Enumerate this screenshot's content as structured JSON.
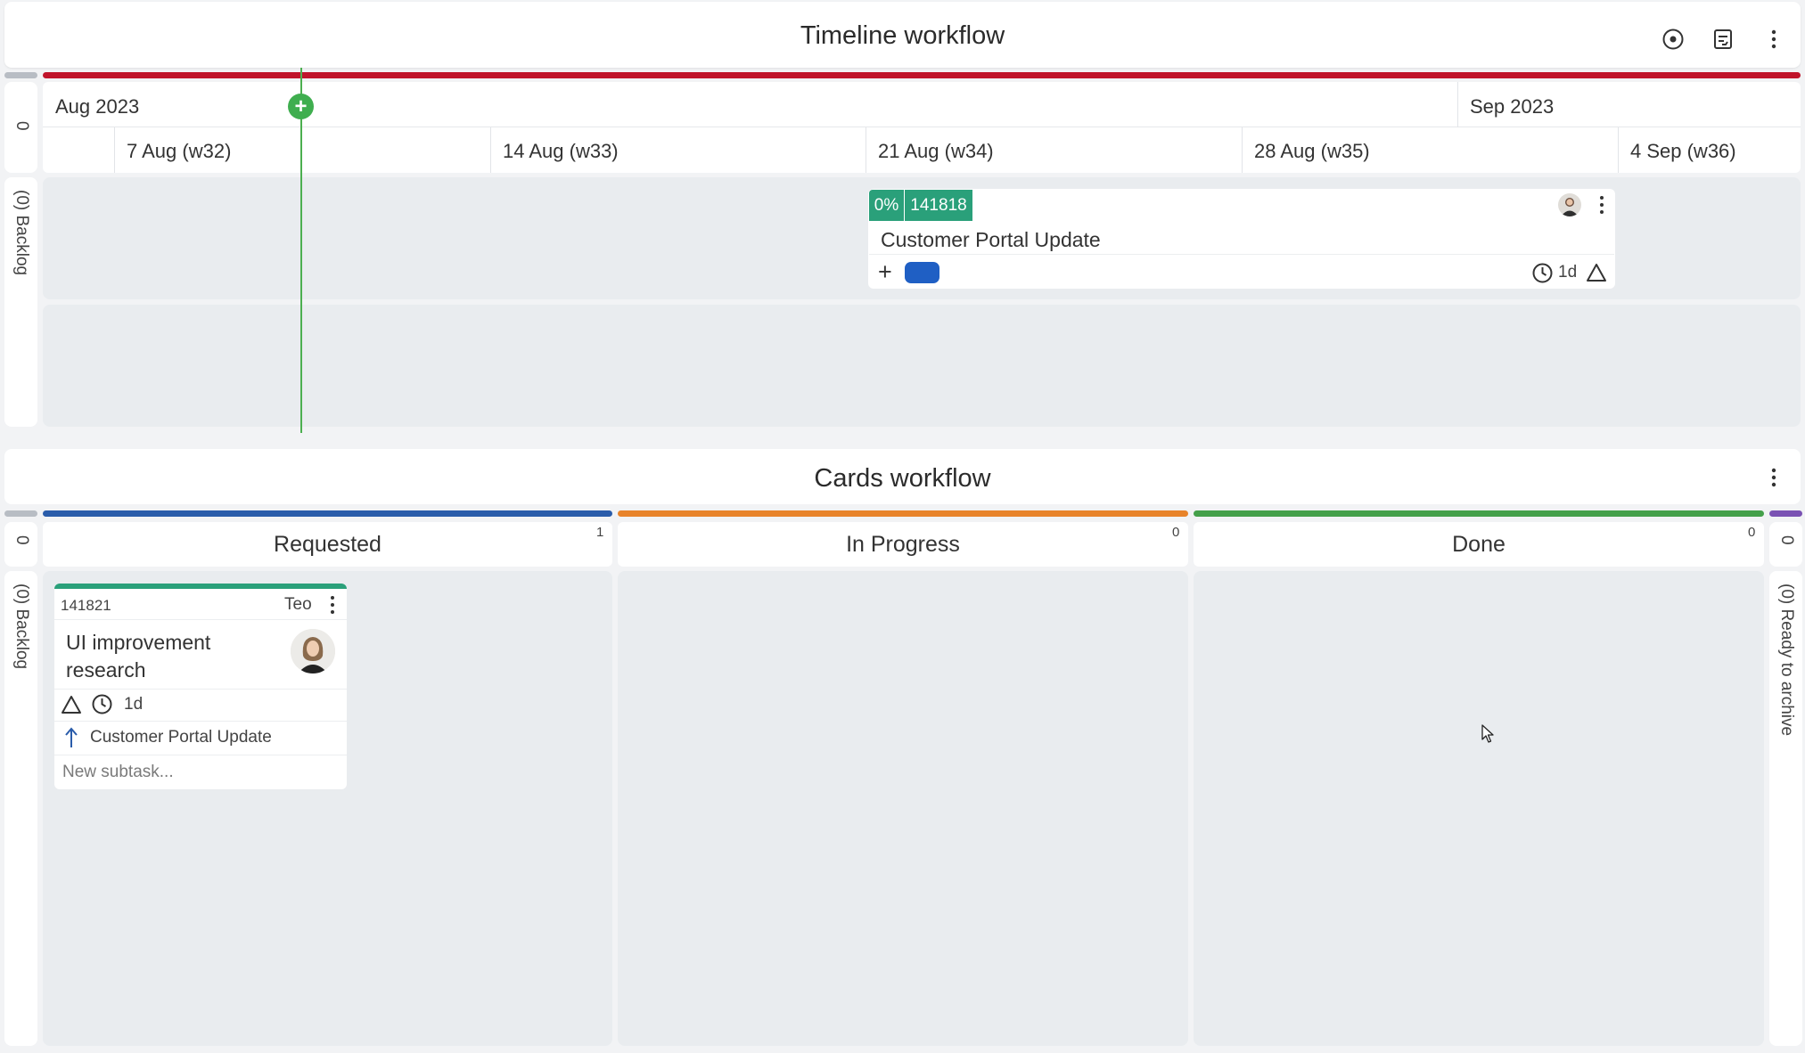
{
  "timeline": {
    "title": "Timeline workflow",
    "left_count": "0",
    "backlog_label": "(0) Backlog",
    "months": [
      "Aug 2023",
      "Sep 2023"
    ],
    "weeks": [
      "7 Aug (w32)",
      "14 Aug (w33)",
      "21 Aug (w34)",
      "28 Aug (w35)",
      "4 Sep (w36)"
    ],
    "today_marker": "+",
    "card": {
      "progress": "0%",
      "id": "141818",
      "title": "Customer Portal Update",
      "add_label": "+",
      "estimate": "1d"
    },
    "icons": [
      "target-icon",
      "report-icon",
      "more-vertical-icon"
    ],
    "accent_color": "#c0142b"
  },
  "cards_workflow": {
    "title": "Cards workflow",
    "left_count": "0",
    "backlog_label": "(0) Backlog",
    "right_count": "0",
    "archive_label": "(0) Ready to archive",
    "columns": [
      {
        "title": "Requested",
        "count": "1",
        "color": "#2a5caa"
      },
      {
        "title": "In Progress",
        "count": "0",
        "color": "#e8832a"
      },
      {
        "title": "Done",
        "count": "0",
        "color": "#44a04a"
      }
    ],
    "card": {
      "id": "141821",
      "owner": "Teo",
      "title": "UI improvement research",
      "estimate": "1d",
      "parent": "Customer Portal Update",
      "subtask_placeholder": "New subtask..."
    }
  }
}
